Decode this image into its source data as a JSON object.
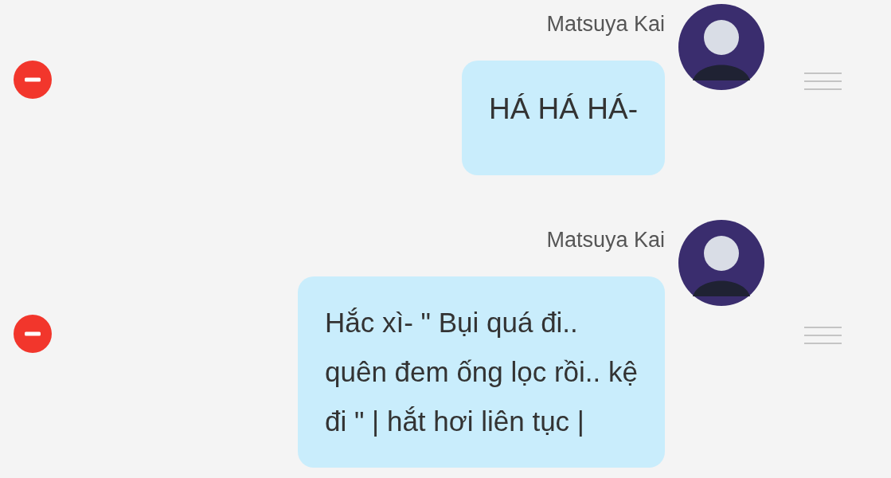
{
  "messages": [
    {
      "sender": "Matsuya Kai",
      "lines": [
        "HÁ HÁ HÁ-"
      ]
    },
    {
      "sender": "Matsuya Kai",
      "lines": [
        "Hắc xì- \" Bụi quá đi..",
        "quên đem ống lọc rồi.. kệ",
        "đi \" | hắt hơi liên tục |"
      ]
    }
  ]
}
